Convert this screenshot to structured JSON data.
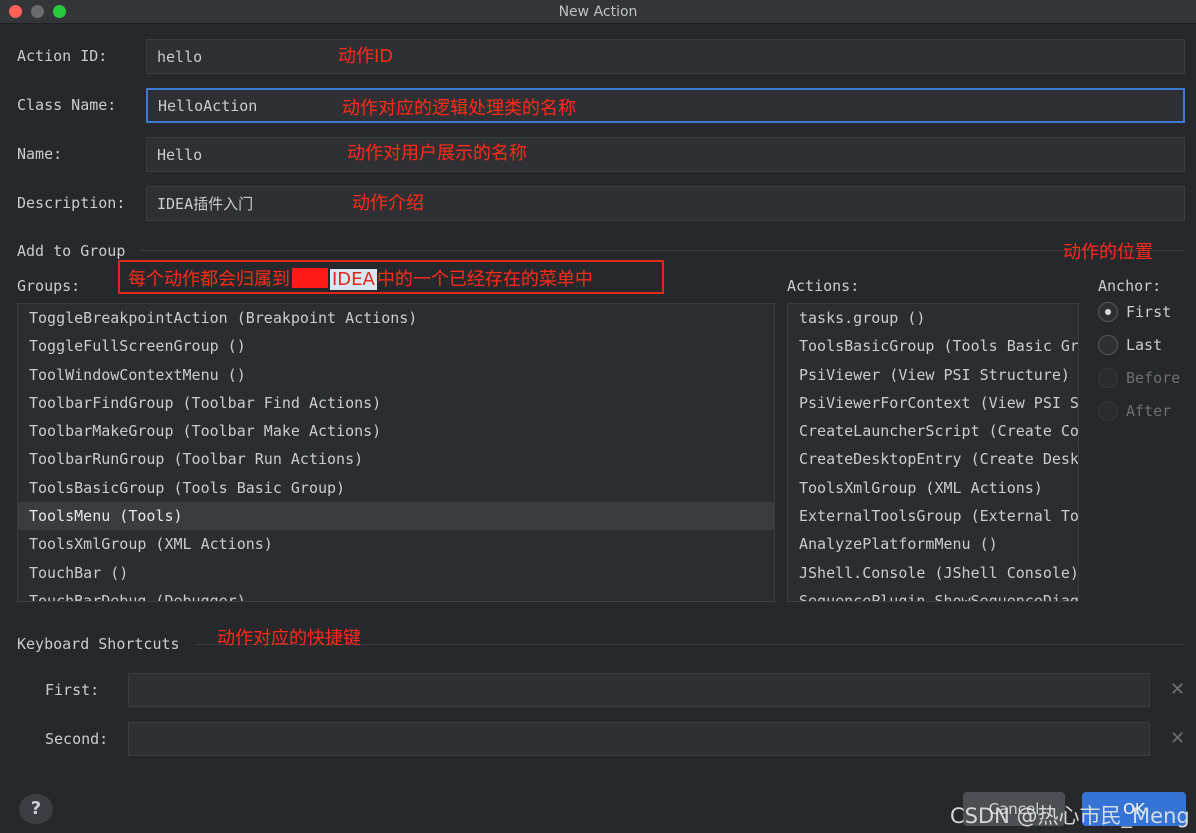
{
  "window": {
    "title": "New Action"
  },
  "form": {
    "action_id_label": "Action ID:",
    "action_id_value": "hello",
    "class_name_label": "Class Name:",
    "class_name_value": "HelloAction",
    "name_label": "Name:",
    "name_value": "Hello",
    "description_label": "Description:",
    "description_value": "IDEA插件入门"
  },
  "annotations": {
    "action_id": "动作ID",
    "class_name": "动作对应的逻辑处理类的名称",
    "name": "动作对用户展示的名称",
    "description": "动作介绍",
    "position": "动作的位置",
    "groups_prefix": "每个动作都会归属到",
    "groups_highlight": "IDEA",
    "groups_suffix": "中的一个已经存在的菜单中",
    "shortcuts": "动作对应的快捷键"
  },
  "add_to_group": {
    "section_title": "Add to Group",
    "groups_label": "Groups:",
    "groups": [
      "ToggleBreakpointAction (Breakpoint Actions)",
      "ToggleFullScreenGroup ()",
      "ToolWindowContextMenu ()",
      "ToolbarFindGroup (Toolbar Find Actions)",
      "ToolbarMakeGroup (Toolbar Make Actions)",
      "ToolbarRunGroup (Toolbar Run Actions)",
      "ToolsBasicGroup (Tools Basic Group)",
      "ToolsMenu (Tools)",
      "ToolsXmlGroup (XML Actions)",
      "TouchBar ()",
      "TouchBarDebug (Debugger)"
    ],
    "selected_group": "ToolsMenu (Tools)",
    "actions_label": "Actions:",
    "actions": [
      "tasks.group ()",
      "ToolsBasicGroup (Tools Basic Group)",
      "PsiViewer (View PSI Structure)",
      "PsiViewerForContext (View PSI Structure of Current File)",
      "CreateLauncherScript (Create Command-line Launcher)",
      "CreateDesktopEntry (Create Desktop Entry)",
      "ToolsXmlGroup (XML Actions)",
      "ExternalToolsGroup (External Tools)",
      "AnalyzePlatformMenu ()",
      "JShell.Console (JShell Console)",
      "SequencePlugin.ShowSequenceDiagram"
    ],
    "anchor_label": "Anchor:",
    "anchor_options": [
      "First",
      "Last",
      "Before",
      "After"
    ],
    "anchor_selected": "First"
  },
  "shortcuts": {
    "section_title": "Keyboard Shortcuts",
    "first_label": "First:",
    "first_value": "",
    "second_label": "Second:",
    "second_value": ""
  },
  "buttons": {
    "help": "?",
    "cancel": "Cancel",
    "ok": "OK"
  },
  "watermark": "CSDN @热心市民_Meng",
  "colors": {
    "background": "#26282b",
    "annotation_red": "#ff2a1a",
    "focus_blue": "#3d7ad1",
    "ok_blue": "#3574d4"
  }
}
